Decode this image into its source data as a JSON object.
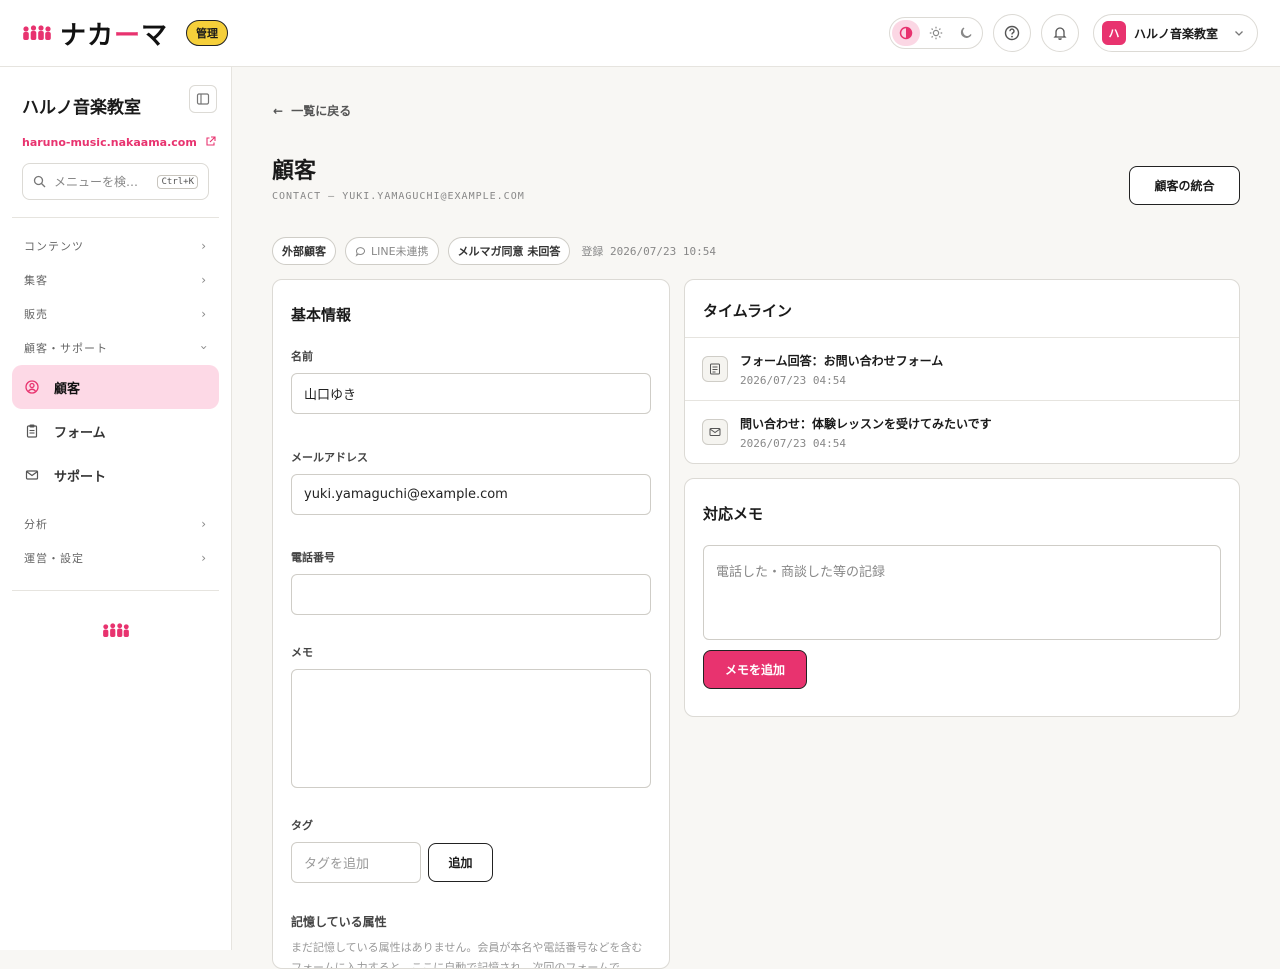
{
  "brand": {
    "name": "ナカーマ",
    "name_main": "ナカ",
    "name_dash": "ー",
    "name_end": "マ",
    "admin_badge": "管理",
    "accent": "#e8336f"
  },
  "header": {
    "theme_modes": [
      "system",
      "light",
      "dark"
    ],
    "active_theme": "system",
    "account_initial": "ハ",
    "account_name": "ハルノ音楽教室"
  },
  "sidebar": {
    "title": "ハルノ音楽教室",
    "url": "haruno-music.nakaama.com",
    "search_placeholder": "メニューを検…",
    "search_shortcut": "Ctrl+K",
    "sections": {
      "contents": "コンテンツ",
      "marketing": "集客",
      "sales": "販売",
      "customer_support": "顧客・サポート",
      "analytics": "分析",
      "operations": "運営・設定"
    },
    "items": {
      "customers": "顧客",
      "forms": "フォーム",
      "support": "サポート"
    }
  },
  "main": {
    "back_link": "一覧に戻る",
    "title": "顧客",
    "subtitle": "CONTACT — YUKI.YAMAGUCHI@EXAMPLE.COM",
    "merge_button": "顧客の統合",
    "chips": {
      "external": "外部顧客",
      "line": "LINE未連携",
      "newsletter": "メルマガ同意 未回答"
    },
    "registered": "登録 2026/07/23 10:54"
  },
  "basic_info": {
    "title": "基本情報",
    "name_label": "名前",
    "name_value": "山口ゆき",
    "email_label": "メールアドレス",
    "email_value": "yuki.yamaguchi@example.com",
    "phone_label": "電話番号",
    "phone_value": "",
    "memo_label": "メモ",
    "tag_label": "タグ",
    "tag_placeholder": "タグを追加",
    "tag_add_button": "追加",
    "attributes_label": "記憶している属性",
    "attributes_hint": "まだ記憶している属性はありません。会員が本名や電話番号などを含むフォームに入力すると、ここに自動で記憶され、次回のフォームで"
  },
  "timeline": {
    "title": "タイムライン",
    "items": [
      {
        "text": "フォーム回答：お問い合わせフォーム",
        "time": "2026/07/23 04:54",
        "icon": "form-icon"
      },
      {
        "text": "問い合わせ：体験レッスンを受けてみたいです",
        "time": "2026/07/23 04:54",
        "icon": "mail-icon"
      }
    ]
  },
  "memo": {
    "title": "対応メモ",
    "placeholder": "電話した・商談した等の記録",
    "add_button": "メモを追加"
  }
}
